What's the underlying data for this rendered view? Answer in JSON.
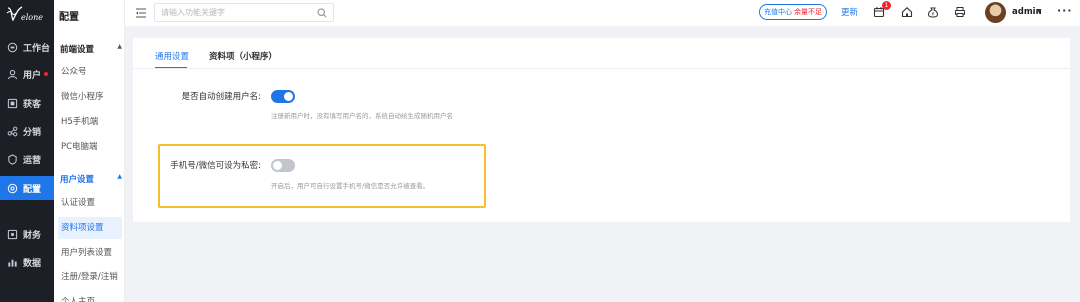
{
  "brand": {
    "logo_text": "Velone"
  },
  "nav": {
    "items": [
      {
        "label": "工作台",
        "icon": "dashboard-icon"
      },
      {
        "label": "用户",
        "icon": "user-icon",
        "dot": true
      },
      {
        "label": "获客",
        "icon": "acquire-icon"
      },
      {
        "label": "分销",
        "icon": "distribution-icon"
      },
      {
        "label": "运营",
        "icon": "operation-icon"
      },
      {
        "label": "配置",
        "icon": "settings-icon",
        "active": true
      },
      {
        "label": "财务",
        "icon": "finance-icon"
      },
      {
        "label": "数据",
        "icon": "chart-icon"
      }
    ]
  },
  "subnav": {
    "title": "配置",
    "group1": {
      "title": "前端设置",
      "items": [
        "公众号",
        "微信小程序",
        "H5手机端",
        "PC电脑端"
      ]
    },
    "group2": {
      "title": "用户设置",
      "items": [
        "认证设置",
        "资料项设置",
        "用户列表设置",
        "注册/登录/注销",
        "个人主页"
      ]
    }
  },
  "topbar": {
    "search_placeholder": "请输入功能关键字",
    "recharge_label": "充值中心",
    "recharge_warning": "余量不足",
    "update_label": "更新",
    "notification_count": "1",
    "username": "admin"
  },
  "tabs": {
    "general": "通用设置",
    "profile": "资料项（小程序）"
  },
  "settings": {
    "auto_create": {
      "label": "是否自动创建用户名:",
      "enabled": true,
      "hint": "注册新用户时，没有填写用户名的，系统自动给生成随机用户名"
    },
    "private_contact": {
      "label": "手机号/微信可设为私密:",
      "enabled": false,
      "hint": "开启后，用户可自行设置手机号/微信是否允许被查看。"
    }
  },
  "colors": {
    "primary": "#1f76e8",
    "nav_bg": "#1c1f26",
    "highlight": "#f5be2c",
    "danger": "#f5222d"
  }
}
